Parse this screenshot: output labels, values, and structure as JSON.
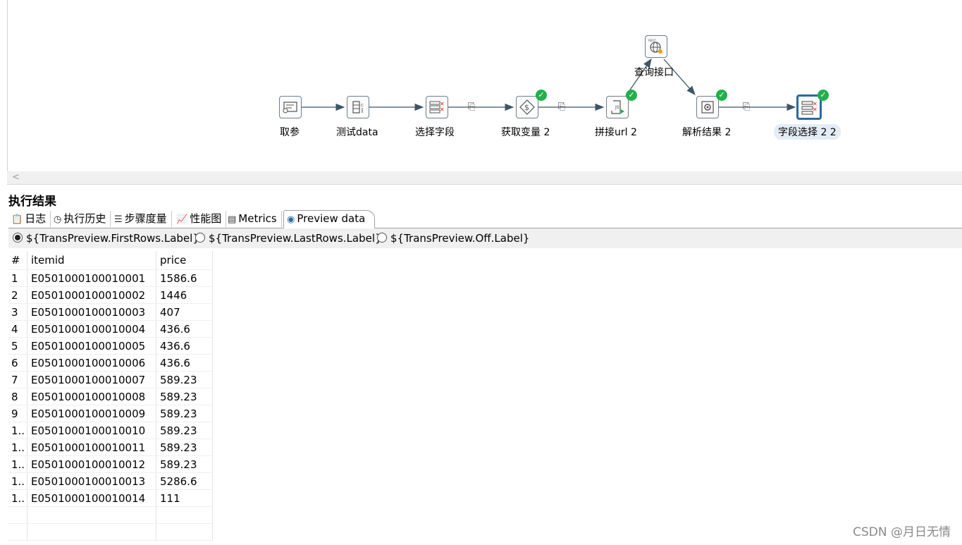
{
  "flow": {
    "nodes": [
      {
        "id": "qucan",
        "label": "取参",
        "checked": false
      },
      {
        "id": "ceshi",
        "label": "测试data",
        "checked": false
      },
      {
        "id": "xuanze1",
        "label": "选择字段",
        "checked": false
      },
      {
        "id": "huoqu",
        "label": "获取变量 2",
        "checked": true
      },
      {
        "id": "pinjie",
        "label": "拼接url 2",
        "checked": true
      },
      {
        "id": "chaxun",
        "label": "查询接口",
        "checked": false
      },
      {
        "id": "jiexi",
        "label": "解析结果 2",
        "checked": true
      },
      {
        "id": "xuanze22",
        "label": "字段选择 2 2",
        "checked": true
      }
    ]
  },
  "results": {
    "title": "执行结果",
    "tabs": [
      {
        "label": "日志",
        "icon": "clipboard-icon"
      },
      {
        "label": "执行历史",
        "icon": "clock-icon"
      },
      {
        "label": "步骤度量",
        "icon": "list-numbers-icon"
      },
      {
        "label": "性能图",
        "icon": "chart-icon"
      },
      {
        "label": "Metrics",
        "icon": "metrics-icon"
      },
      {
        "label": "Preview data",
        "icon": "eye-icon"
      }
    ],
    "active_tab": "Preview data",
    "radio": {
      "first": "${TransPreview.FirstRows.Label}",
      "last": "${TransPreview.LastRows.Label}",
      "off": "${TransPreview.Off.Label}"
    },
    "table": {
      "headers": [
        "#",
        "itemid",
        "price"
      ],
      "rows": [
        [
          "1",
          "E0501000100010001",
          "1586.6"
        ],
        [
          "2",
          "E0501000100010002",
          "1446"
        ],
        [
          "3",
          "E0501000100010003",
          "407"
        ],
        [
          "4",
          "E0501000100010004",
          "436.6"
        ],
        [
          "5",
          "E0501000100010005",
          "436.6"
        ],
        [
          "6",
          "E0501000100010006",
          "436.6"
        ],
        [
          "7",
          "E0501000100010007",
          "589.23"
        ],
        [
          "8",
          "E0501000100010008",
          "589.23"
        ],
        [
          "9",
          "E0501000100010009",
          "589.23"
        ],
        [
          "1..",
          "E0501000100010010",
          "589.23"
        ],
        [
          "1..",
          "E0501000100010011",
          "589.23"
        ],
        [
          "1..",
          "E0501000100010012",
          "589.23"
        ],
        [
          "1..",
          "E0501000100010013",
          "5286.6"
        ],
        [
          "1..",
          "E0501000100010014",
          "111"
        ]
      ]
    }
  },
  "watermark": "CSDN @月日无情"
}
